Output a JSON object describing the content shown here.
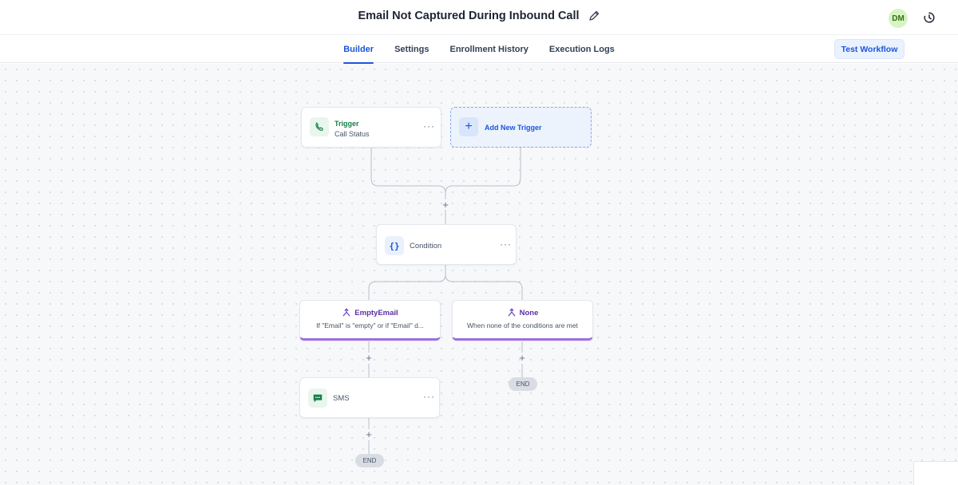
{
  "header": {
    "title": "Email Not Captured During Inbound Call",
    "avatar_initials": "DM"
  },
  "tabs": [
    {
      "label": "Builder",
      "active": true
    },
    {
      "label": "Settings",
      "active": false
    },
    {
      "label": "Enrollment History",
      "active": false
    },
    {
      "label": "Execution Logs",
      "active": false
    }
  ],
  "actions": {
    "test_workflow": "Test Workflow"
  },
  "workflow": {
    "trigger": {
      "title": "Trigger",
      "subtitle": "Call Status",
      "menu": "···",
      "icon": "phone-icon"
    },
    "add_trigger": {
      "label": "Add New Trigger",
      "icon": "plus-icon"
    },
    "condition": {
      "label": "Condition",
      "menu": "···",
      "icon": "braces-icon"
    },
    "branches": [
      {
        "title": "EmptyEmail",
        "description": "If \"Email\" is \"empty\" or if \"Email\" d...",
        "icon": "branch-icon"
      },
      {
        "title": "None",
        "description": "When none of the conditions are met",
        "icon": "branch-icon"
      }
    ],
    "sms": {
      "label": "SMS",
      "menu": "···",
      "icon": "message-icon"
    },
    "plus_symbol": "+",
    "end_label": "END"
  },
  "colors": {
    "accent": "#1a56db",
    "trigger_green": "#167e47",
    "branch_purple": "#9d6ee0",
    "avatar_bg": "#d6f5c2"
  }
}
